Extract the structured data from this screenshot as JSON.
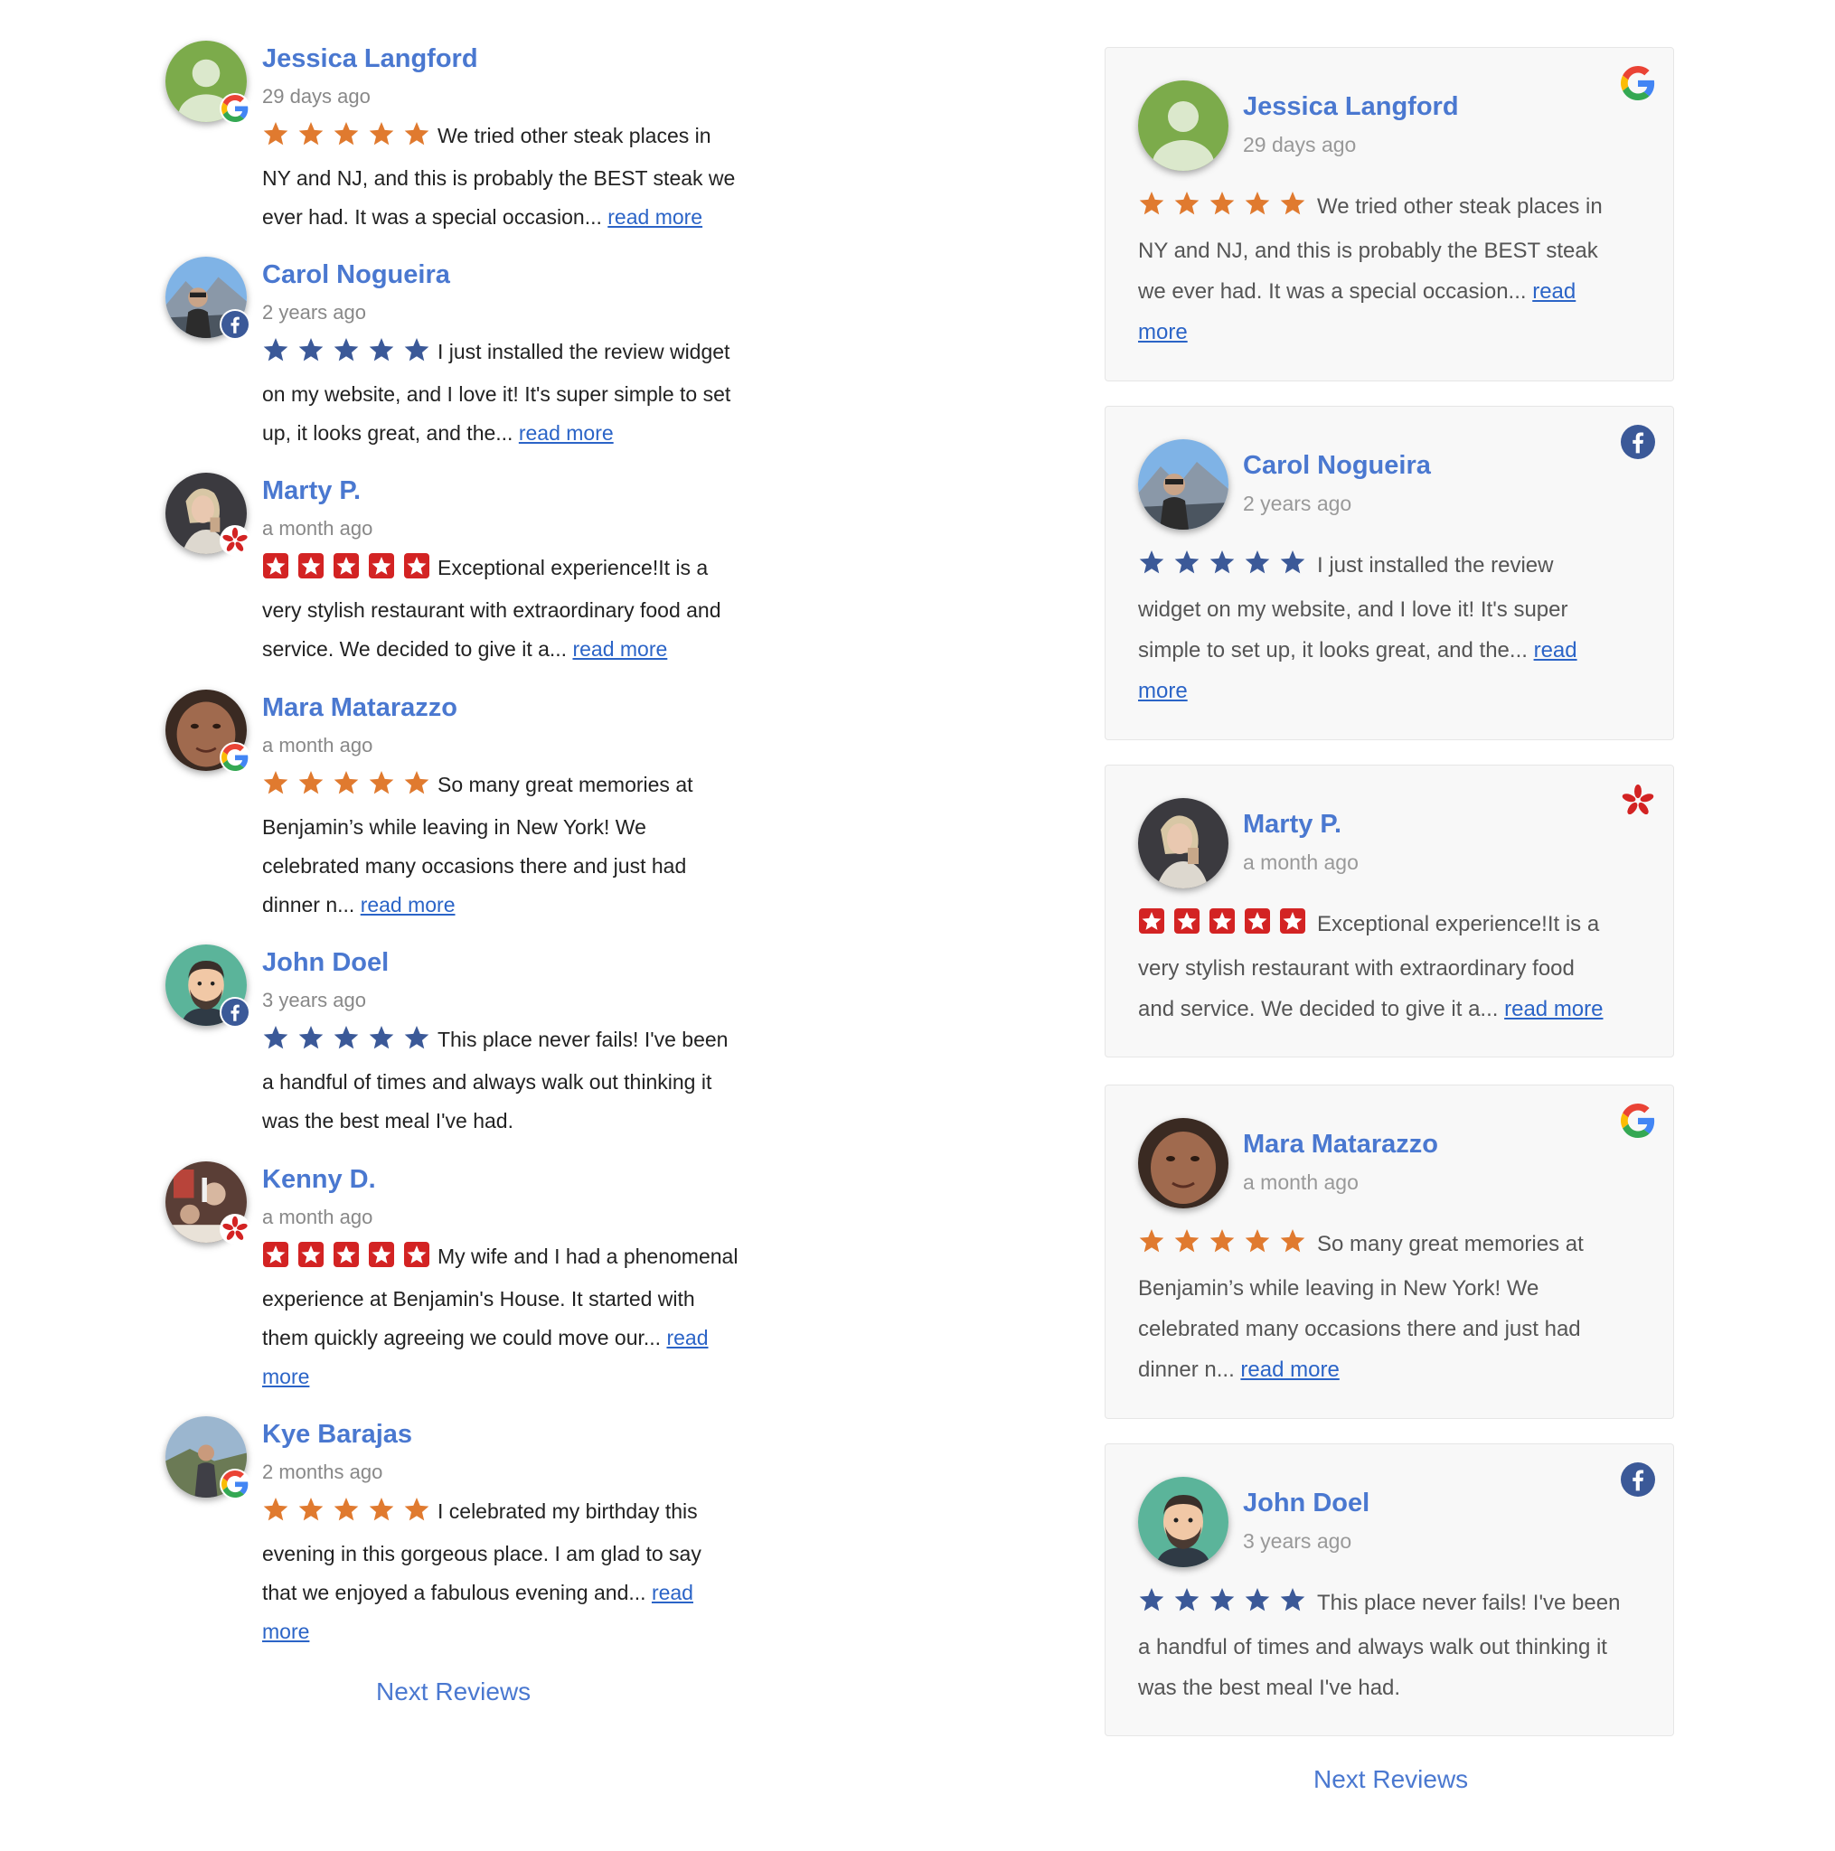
{
  "colors": {
    "name": "#4a78d0",
    "google_star": "#e07a2f",
    "facebook_star": "#3b5998",
    "yelp_star_bg": "#d32323",
    "link": "#2b64c7"
  },
  "left": {
    "reviews": [
      {
        "name": "Jessica Langford",
        "time": "29 days ago",
        "platform": "google",
        "lines": [
          "We tried other steak places in",
          "NY and NJ, and this is probably the BEST steak we",
          "ever had. It was a special occasion... "
        ],
        "readmore": [
          "read more"
        ]
      },
      {
        "name": "Carol Nogueira",
        "time": "2 years ago",
        "platform": "facebook",
        "lines": [
          "I just installed the review widget",
          "on my website, and I love it! It's super simple to set",
          "up, it looks great, and the... "
        ],
        "readmore": [
          "read more"
        ]
      },
      {
        "name": "Marty P.",
        "time": "a month ago",
        "platform": "yelp",
        "lines": [
          "Exceptional experience!It is a",
          "very stylish restaurant with extraordinary food and",
          "service. We decided to give it a... "
        ],
        "readmore": [
          "read more"
        ]
      },
      {
        "name": "Mara Matarazzo",
        "time": "a month ago",
        "platform": "google",
        "lines": [
          "So many great memories at",
          "Benjamin’s while leaving in New York! We",
          "celebrated  many occasions there and just had",
          "dinner n... "
        ],
        "readmore": [
          "read more"
        ]
      },
      {
        "name": "John Doel",
        "time": "3 years ago",
        "platform": "facebook",
        "lines": [
          "This place never fails! I've been",
          "a handful of times and always walk out  thinking it",
          "was the best meal I've had."
        ],
        "readmore": []
      },
      {
        "name": "Kenny D.",
        "time": "a month ago",
        "platform": "yelp",
        "lines": [
          "My wife and I had a phenomenal",
          "experience at Benjamin's House. It started with",
          "them quickly agreeing we could move our... "
        ],
        "readmore": [
          "read ",
          "more"
        ]
      },
      {
        "name": "Kye Barajas",
        "time": "2 months ago",
        "platform": "google",
        "lines": [
          "I celebrated my birthday this",
          "evening in this gorgeous place. I am glad to say",
          "that we enjoyed a fabulous evening and... "
        ],
        "readmore": [
          "read ",
          "more"
        ]
      }
    ],
    "next_label": "Next Reviews"
  },
  "right": {
    "cards": [
      {
        "name": "Jessica Langford",
        "time": "29 days ago",
        "platform": "google",
        "lines": [
          "We tried other steak places in",
          "NY and NJ, and this is probably the BEST steak",
          "we ever had. It was a special occasion... "
        ],
        "readmore": [
          "read",
          "more"
        ]
      },
      {
        "name": "Carol Nogueira",
        "time": "2 years ago",
        "platform": "facebook",
        "lines": [
          "I just installed the review",
          "widget on my website, and I love it! It's super",
          "simple to set up, it looks great, and the... "
        ],
        "readmore": [
          "read",
          "more"
        ]
      },
      {
        "name": "Marty P.",
        "time": "a month ago",
        "platform": "yelp",
        "lines": [
          "Exceptional experience!It is a",
          "very stylish restaurant with extraordinary food",
          "and service. We decided to give it a... "
        ],
        "readmore": [
          "read more"
        ]
      },
      {
        "name": "Mara Matarazzo",
        "time": "a month ago",
        "platform": "google",
        "lines": [
          "So many great memories at",
          "Benjamin’s while leaving in New York! We",
          "celebrated many occasions there and just had",
          "dinner n... "
        ],
        "readmore": [
          "read more"
        ]
      },
      {
        "name": "John Doel",
        "time": "3 years ago",
        "platform": "facebook",
        "lines": [
          "This place never fails! I've been",
          "a handful of times and always walk out thinking it",
          "was the best meal I've had."
        ],
        "readmore": []
      }
    ],
    "next_label": "Next Reviews"
  }
}
